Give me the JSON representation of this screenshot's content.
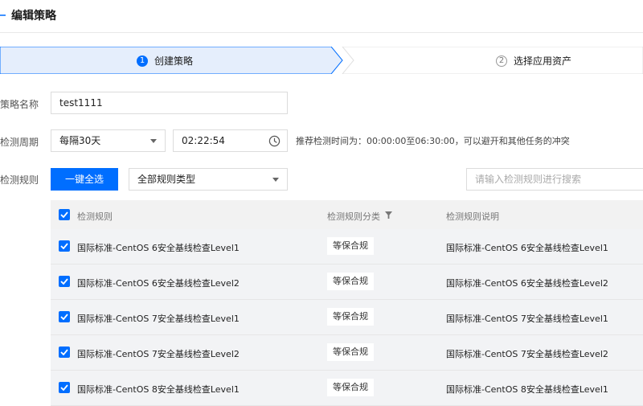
{
  "header": {
    "title": "编辑策略"
  },
  "steps": [
    {
      "num": "1",
      "label": "创建策略"
    },
    {
      "num": "2",
      "label": "选择应用资产"
    }
  ],
  "form": {
    "name_label": "策略名称",
    "name_value": "test1111",
    "period_label": "检测周期",
    "period_value": "每隔30天",
    "time_value": "02:22:54",
    "period_hint": "推荐检测时间为：00:00:00至06:30:00，可以避开和其他任务的冲突",
    "rules_label": "检测规则",
    "select_all_label": "一键全选",
    "rule_type_value": "全部规则类型",
    "search_placeholder": "请输入检测规则进行搜索"
  },
  "table": {
    "headers": {
      "rule": "检测规则",
      "category": "检测规则分类",
      "description": "检测规则说明"
    },
    "rows": [
      {
        "rule": "国际标准-CentOS 6安全基线检查Level1",
        "category": "等保合规",
        "description": "国际标准-CentOS 6安全基线检查Level1",
        "checked": true
      },
      {
        "rule": "国际标准-CentOS 6安全基线检查Level2",
        "category": "等保合规",
        "description": "国际标准-CentOS 6安全基线检查Level2",
        "checked": true
      },
      {
        "rule": "国际标准-CentOS 7安全基线检查Level1",
        "category": "等保合规",
        "description": "国际标准-CentOS 7安全基线检查Level1",
        "checked": true
      },
      {
        "rule": "国际标准-CentOS 7安全基线检查Level2",
        "category": "等保合规",
        "description": "国际标准-CentOS 7安全基线检查Level2",
        "checked": true
      },
      {
        "rule": "国际标准-CentOS 8安全基线检查Level1",
        "category": "等保合规",
        "description": "国际标准-CentOS 8安全基线检查Level1",
        "checked": true
      }
    ]
  },
  "colors": {
    "accent": "#006eff",
    "step_active_bg": "#e5eefc"
  }
}
